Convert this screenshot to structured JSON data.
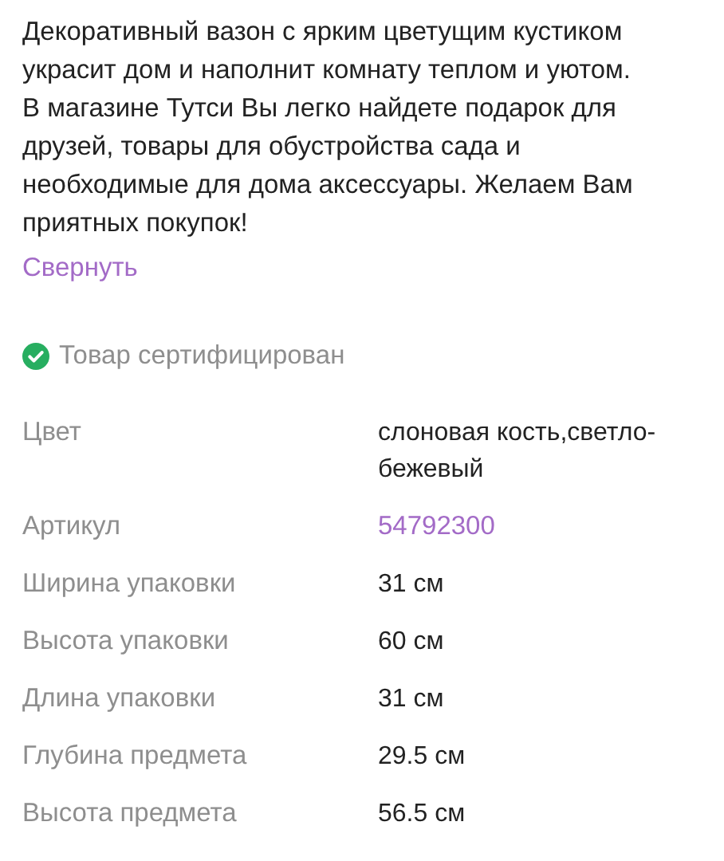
{
  "description": {
    "lines": [
      "Декоративный вазон с ярким цветущим кустиком",
      "украсит дом и наполнит комнату теплом и уютом.",
      "В магазине Тутси Вы легко найдете подарок для",
      "друзей, товары для обустройства сада и",
      "необходимые для дома аксессуары. Желаем Вам",
      "приятных покупок!"
    ]
  },
  "collapse_link": "Свернуть",
  "certified": {
    "label": "Товар сертифицирован"
  },
  "specs": [
    {
      "label": "Цвет",
      "value": "слоновая кость,светло-бежевый",
      "kind": "text"
    },
    {
      "label": "Артикул",
      "value": "54792300",
      "kind": "link"
    },
    {
      "label": "Ширина упаковки",
      "value": "31 см",
      "kind": "text"
    },
    {
      "label": "Высота упаковки",
      "value": "60 см",
      "kind": "text"
    },
    {
      "label": "Длина упаковки",
      "value": "31 см",
      "kind": "text"
    },
    {
      "label": "Глубина предмета",
      "value": "29.5 см",
      "kind": "text"
    },
    {
      "label": "Высота предмета",
      "value": "56.5 см",
      "kind": "text"
    }
  ]
}
